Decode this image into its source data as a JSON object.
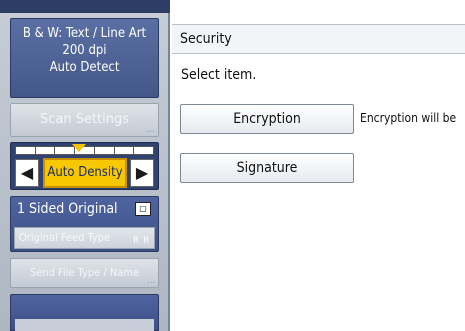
{
  "left_panel": {
    "mode": {
      "line1": "B & W: Text / Line Art",
      "line2": "200 dpi",
      "line3": "Auto Detect"
    },
    "scan_settings_label": "Scan Settings",
    "density": {
      "label": "Auto Density",
      "left_arrow": "◀",
      "right_arrow": "▶",
      "marker_level": 4,
      "levels": 7
    },
    "sided_label": "1 Sided Original",
    "duplex_icon": "duplex-icon",
    "feed_type_label": "Original Feed Type",
    "feed_icons": "R R",
    "send_file_label": "Send File Type / Name",
    "ellipsis": "..."
  },
  "dialog": {
    "title": "Security",
    "prompt": "Select item.",
    "encryption_button": "Encryption",
    "encryption_desc": "Encryption will be",
    "signature_button": "Signature"
  },
  "colors": {
    "accent_yellow": "#f7c700",
    "panel_blue": "#44578a"
  }
}
